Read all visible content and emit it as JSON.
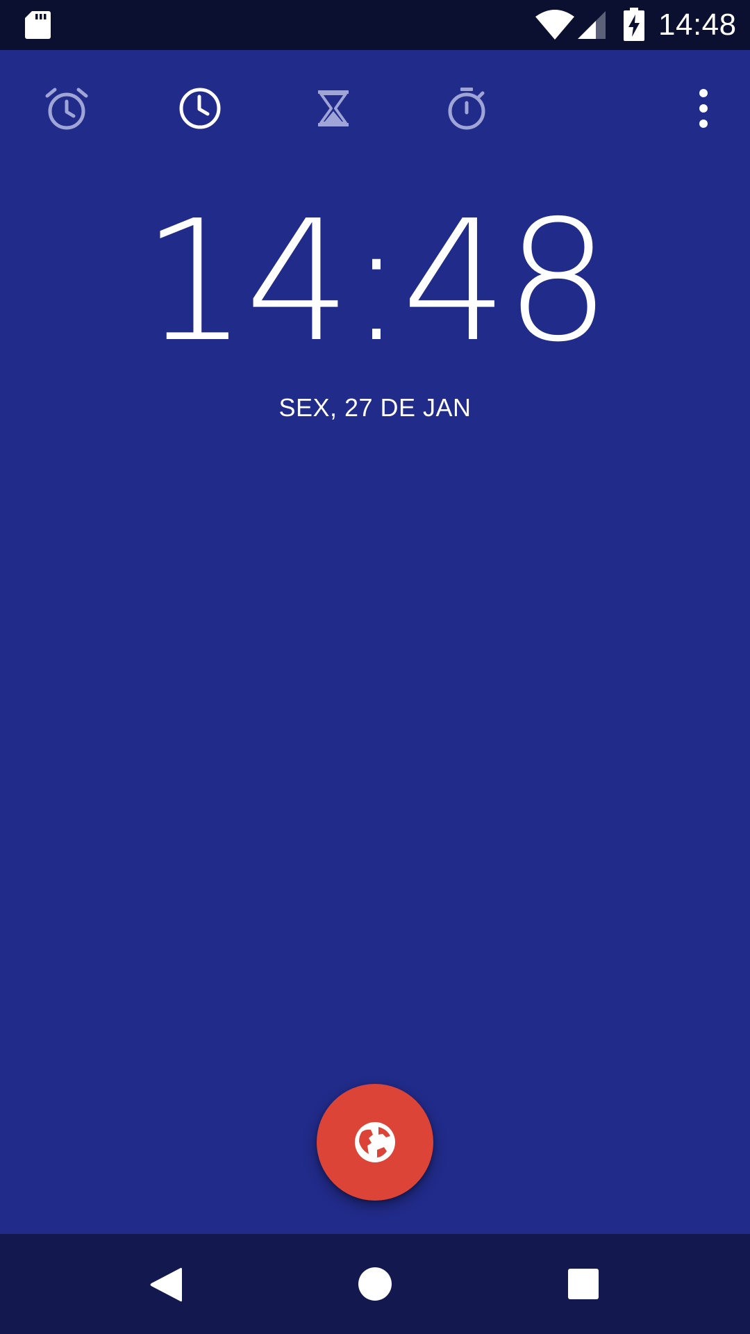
{
  "status_bar": {
    "time": "14:48",
    "icons": [
      "sd-card-icon",
      "wifi-icon",
      "signal-icon",
      "battery-charging-icon"
    ]
  },
  "tabs": [
    {
      "name": "alarm",
      "icon": "alarm-icon",
      "active": false
    },
    {
      "name": "clock",
      "icon": "clock-icon",
      "active": true
    },
    {
      "name": "timer",
      "icon": "hourglass-icon",
      "active": false
    },
    {
      "name": "stopwatch",
      "icon": "stopwatch-icon",
      "active": false
    }
  ],
  "overflow_icon": "more-vert-icon",
  "clock": {
    "time": "14:48",
    "date": "SEX, 27 DE JAN"
  },
  "fab": {
    "icon": "globe-icon"
  },
  "nav_bar": {
    "icons": [
      "back-icon",
      "home-icon",
      "recents-icon"
    ]
  },
  "colors": {
    "background": "#212b89",
    "status_bar": "#0b0f30",
    "nav_bar": "#13194f",
    "fab": "#db4437",
    "inactive_icon": "#9fa5d6",
    "active_icon": "#ffffff"
  }
}
